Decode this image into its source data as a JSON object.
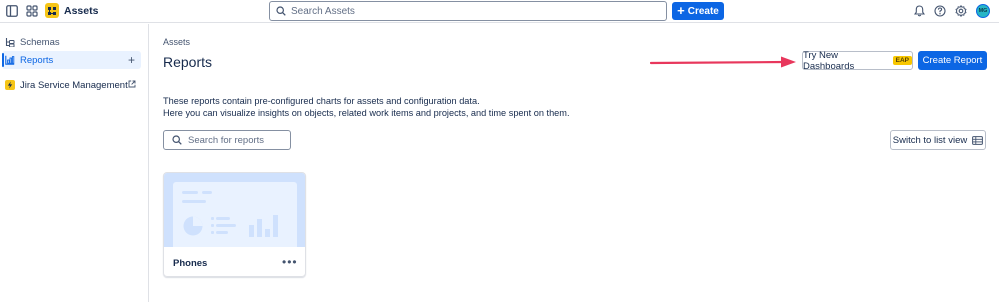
{
  "topbar": {
    "app_name": "Assets",
    "search_placeholder": "Search Assets",
    "create_label": "Create",
    "avatar_initials": "MG"
  },
  "sidebar": {
    "items": [
      {
        "label": "Schemas",
        "icon": "hierarchy-icon"
      },
      {
        "label": "Reports",
        "icon": "bar-chart-icon",
        "active": true
      },
      {
        "label": "Jira Service Management",
        "icon": "jsm-bolt-icon"
      }
    ]
  },
  "main": {
    "breadcrumb": "Assets",
    "title": "Reports",
    "try_dashboards_label": "Try New Dashboards",
    "eap_badge": "EAP",
    "create_report_label": "Create Report",
    "description_line1": "These reports contain pre-configured charts for assets and configuration data.",
    "description_line2": "Here you can visualize insights on objects, related work items and projects, and time spent on them.",
    "report_search_placeholder": "Search for reports",
    "list_view_label": "Switch to list view"
  },
  "cards": [
    {
      "name": "Phones"
    }
  ],
  "colors": {
    "primary": "#0c66e4",
    "arrow": "#e8375c",
    "eap": "#f8c700",
    "logo": "#f5c518"
  }
}
